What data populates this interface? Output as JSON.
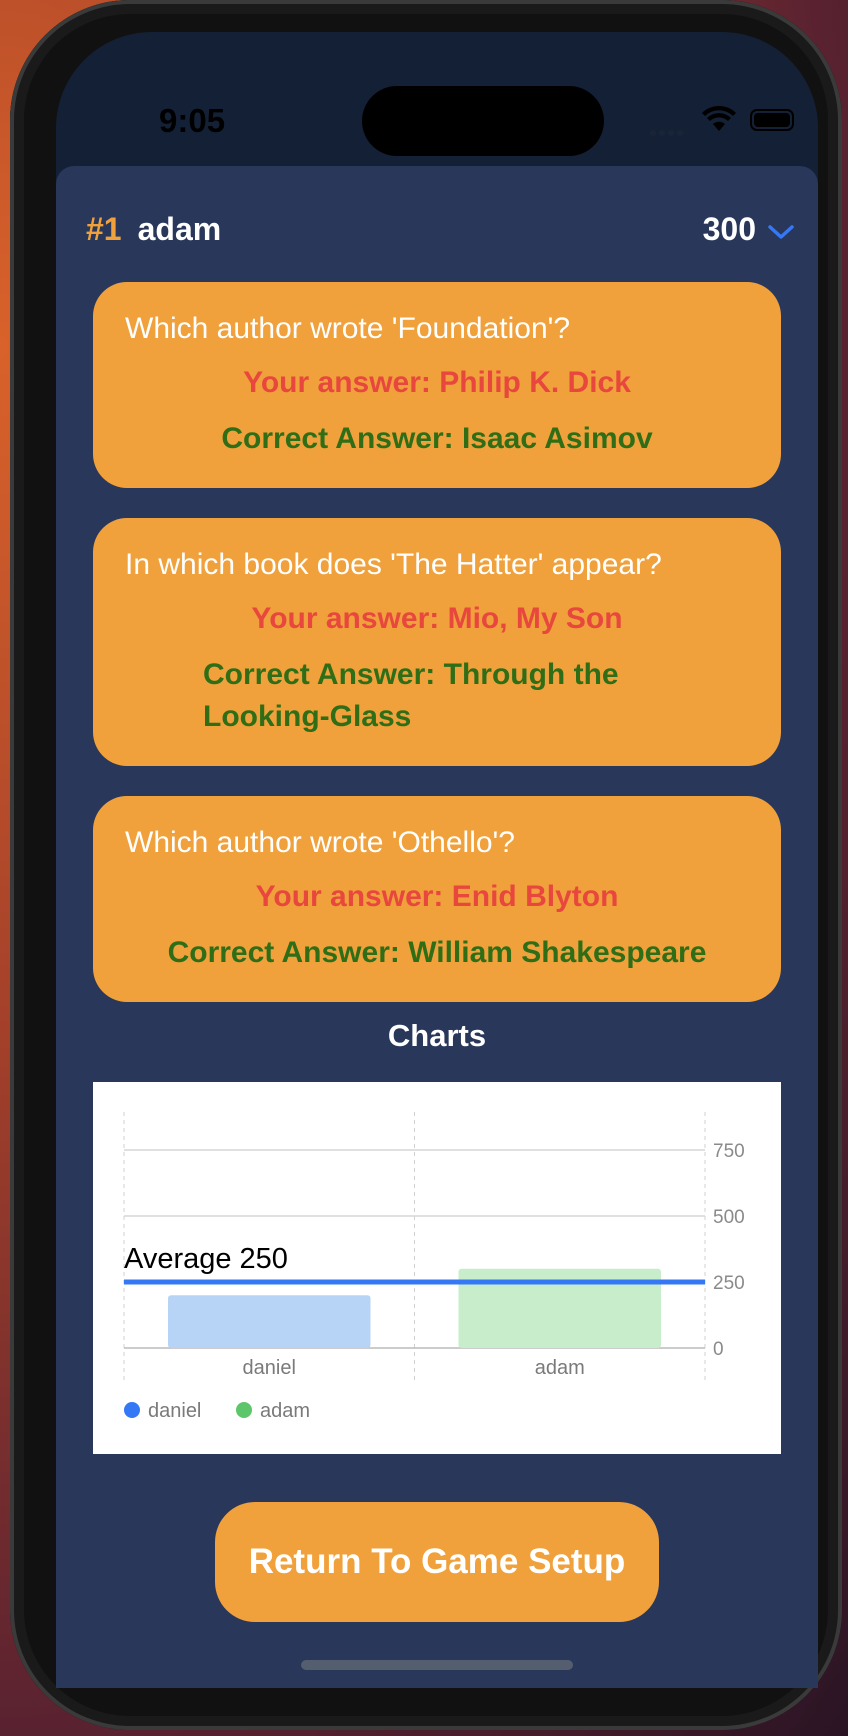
{
  "status_bar": {
    "time": "9:05"
  },
  "header": {
    "rank": "#1",
    "player": "adam",
    "score": "300"
  },
  "answers": [
    {
      "question": "Which author wrote 'Foundation'?",
      "your_answer": "Your answer: Philip K. Dick",
      "correct_answer": "Correct Answer: Isaac Asimov"
    },
    {
      "question": "In which book does 'The Hatter' appear?",
      "your_answer": "Your answer: Mio, My Son",
      "correct_answer": "Correct Answer: Through the Looking-Glass"
    },
    {
      "question": "Which author wrote 'Othello'?",
      "your_answer": "Your answer: Enid Blyton",
      "correct_answer": "Correct Answer: William Shakespeare"
    }
  ],
  "charts_title": "Charts",
  "chart_data": {
    "type": "bar",
    "categories": [
      "daniel",
      "adam"
    ],
    "values": [
      200,
      300
    ],
    "colors": [
      "#b7d3f6",
      "#c8edcb"
    ],
    "legend": [
      {
        "name": "daniel",
        "color": "#3478f6"
      },
      {
        "name": "adam",
        "color": "#5ec66a"
      }
    ],
    "y_ticks": [
      "0",
      "250",
      "500",
      "750"
    ],
    "ylim": [
      0,
      750
    ],
    "average": {
      "value": 250,
      "label": "Average 250",
      "color": "#3478f6"
    },
    "legend_position": "bottom-left"
  },
  "return_button": "Return To Game Setup",
  "colors": {
    "accent": "#f0a13b",
    "background": "#28375a",
    "wrong": "#e8473e",
    "right": "#2f6e17",
    "chevron": "#3478f6"
  }
}
